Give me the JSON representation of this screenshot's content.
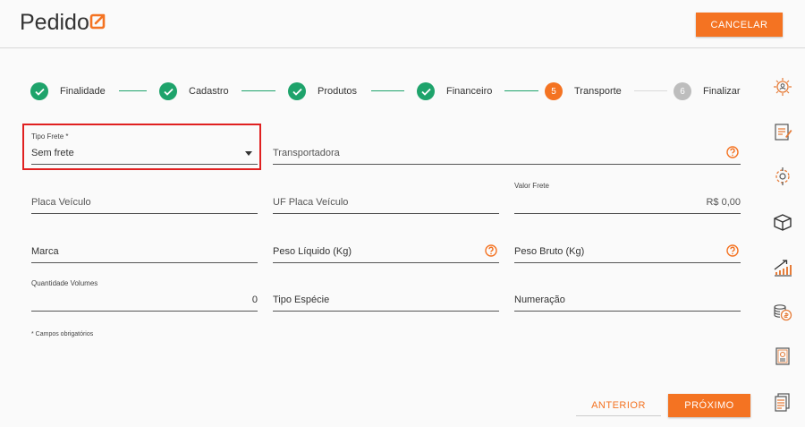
{
  "header": {
    "title": "Pedido",
    "cancel_label": "CANCELAR"
  },
  "steps": [
    {
      "label": "Finalidade",
      "status": "done",
      "marker": ""
    },
    {
      "label": "Cadastro",
      "status": "done",
      "marker": ""
    },
    {
      "label": "Produtos",
      "status": "done",
      "marker": ""
    },
    {
      "label": "Financeiro",
      "status": "done",
      "marker": ""
    },
    {
      "label": "Transporte",
      "status": "active",
      "marker": "5"
    },
    {
      "label": "Finalizar",
      "status": "pending",
      "marker": "6"
    }
  ],
  "form": {
    "tipo_frete": {
      "label": "Tipo Frete *",
      "value": "Sem frete"
    },
    "transportadora": {
      "placeholder": "Transportadora"
    },
    "placa_veiculo": {
      "placeholder": "Placa Veículo"
    },
    "uf_placa": {
      "placeholder": "UF Placa Veículo"
    },
    "valor_frete": {
      "label": "Valor Frete",
      "value": "R$ 0,00"
    },
    "marca": {
      "placeholder": "Marca"
    },
    "peso_liquido": {
      "placeholder": "Peso Líquido (Kg)"
    },
    "peso_bruto": {
      "placeholder": "Peso Bruto (Kg)"
    },
    "quantidade_volumes": {
      "label": "Quantidade Volumes",
      "value": "0"
    },
    "tipo_especie": {
      "placeholder": "Tipo Espécie"
    },
    "numeracao": {
      "placeholder": "Numeração"
    },
    "required_note": "* Campos obrigatórios"
  },
  "footer": {
    "prev_label": "ANTERIOR",
    "next_label": "PRÓXIMO"
  },
  "sidebar_icons": [
    "finalidade-icon",
    "cadastro-icon",
    "produtos-icon",
    "transporte-box-icon",
    "growth-chart-icon",
    "coins-icon",
    "certificate-icon",
    "documents-icon"
  ],
  "colors": {
    "accent": "#f47322",
    "done": "#1ea36b",
    "pending": "#bdbdbd",
    "highlight_border": "#e02020"
  }
}
